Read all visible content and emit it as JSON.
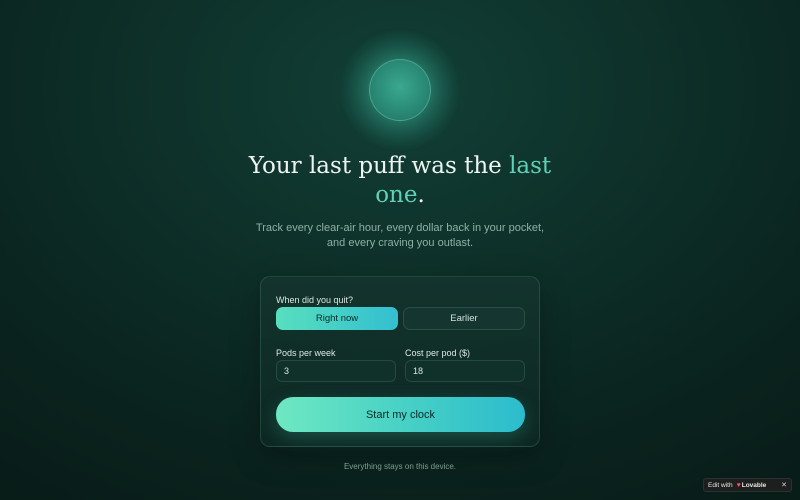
{
  "hero": {
    "headline_main": "Your last puff was the ",
    "headline_accent_1": "last",
    "headline_accent_2": "one",
    "headline_end": ".",
    "subtitle_line1": "Track every clear-air hour, every dollar back in your pocket,",
    "subtitle_line2": "and every craving you outlast."
  },
  "form": {
    "quit_label": "When did you quit?",
    "options": [
      "Right now",
      "Earlier"
    ],
    "selected_option": "Right now",
    "pods_label": "Pods per week",
    "pods_value": "3",
    "cost_label": "Cost per pod ($)",
    "cost_value": "18",
    "submit_label": "Start my clock"
  },
  "footer": {
    "note": "Everything stays on this device."
  },
  "badge": {
    "edit_text": "Edit with",
    "brand": "Lovable",
    "close": "✕"
  },
  "colors": {
    "accent": "#5fd1b6",
    "gradient_start": "#58dfbe",
    "gradient_end": "#33bfd0",
    "background": "#0d2f28"
  }
}
